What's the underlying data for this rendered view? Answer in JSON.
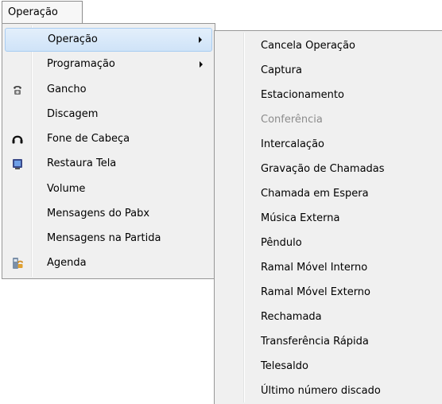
{
  "menubar": {
    "label": "Operação"
  },
  "main_menu": {
    "items": [
      {
        "label": "Operação",
        "icon": null,
        "submenu": true,
        "highlighted": true
      },
      {
        "label": "Programação",
        "icon": null,
        "submenu": true
      },
      {
        "label": "Gancho",
        "icon": "telephone-icon"
      },
      {
        "label": "Discagem",
        "icon": null
      },
      {
        "label": "Fone de Cabeça",
        "icon": "headset-icon"
      },
      {
        "label": "Restaura Tela",
        "icon": "monitor-icon"
      },
      {
        "label": "Volume",
        "icon": null
      },
      {
        "label": "Mensagens do Pabx",
        "icon": null
      },
      {
        "label": "Mensagens na Partida",
        "icon": null
      },
      {
        "label": "Agenda",
        "icon": "phonebook-icon"
      }
    ]
  },
  "sub_menu": {
    "items": [
      {
        "label": "Cancela Operação"
      },
      {
        "label": "Captura"
      },
      {
        "label": "Estacionamento"
      },
      {
        "label": "Conferência",
        "disabled": true
      },
      {
        "label": "Intercalação"
      },
      {
        "label": "Gravação de Chamadas"
      },
      {
        "label": "Chamada em Espera"
      },
      {
        "label": "Música Externa"
      },
      {
        "label": "Pêndulo"
      },
      {
        "label": "Ramal Móvel Interno"
      },
      {
        "label": "Ramal Móvel Externo"
      },
      {
        "label": "Rechamada"
      },
      {
        "label": "Transferência Rápida"
      },
      {
        "label": "Telesaldo"
      },
      {
        "label": "Último número discado"
      }
    ]
  },
  "colors": {
    "highlight": "#cfe3f8",
    "disabled_text": "#8c8c8c",
    "menu_bg": "#f0f0f0"
  }
}
